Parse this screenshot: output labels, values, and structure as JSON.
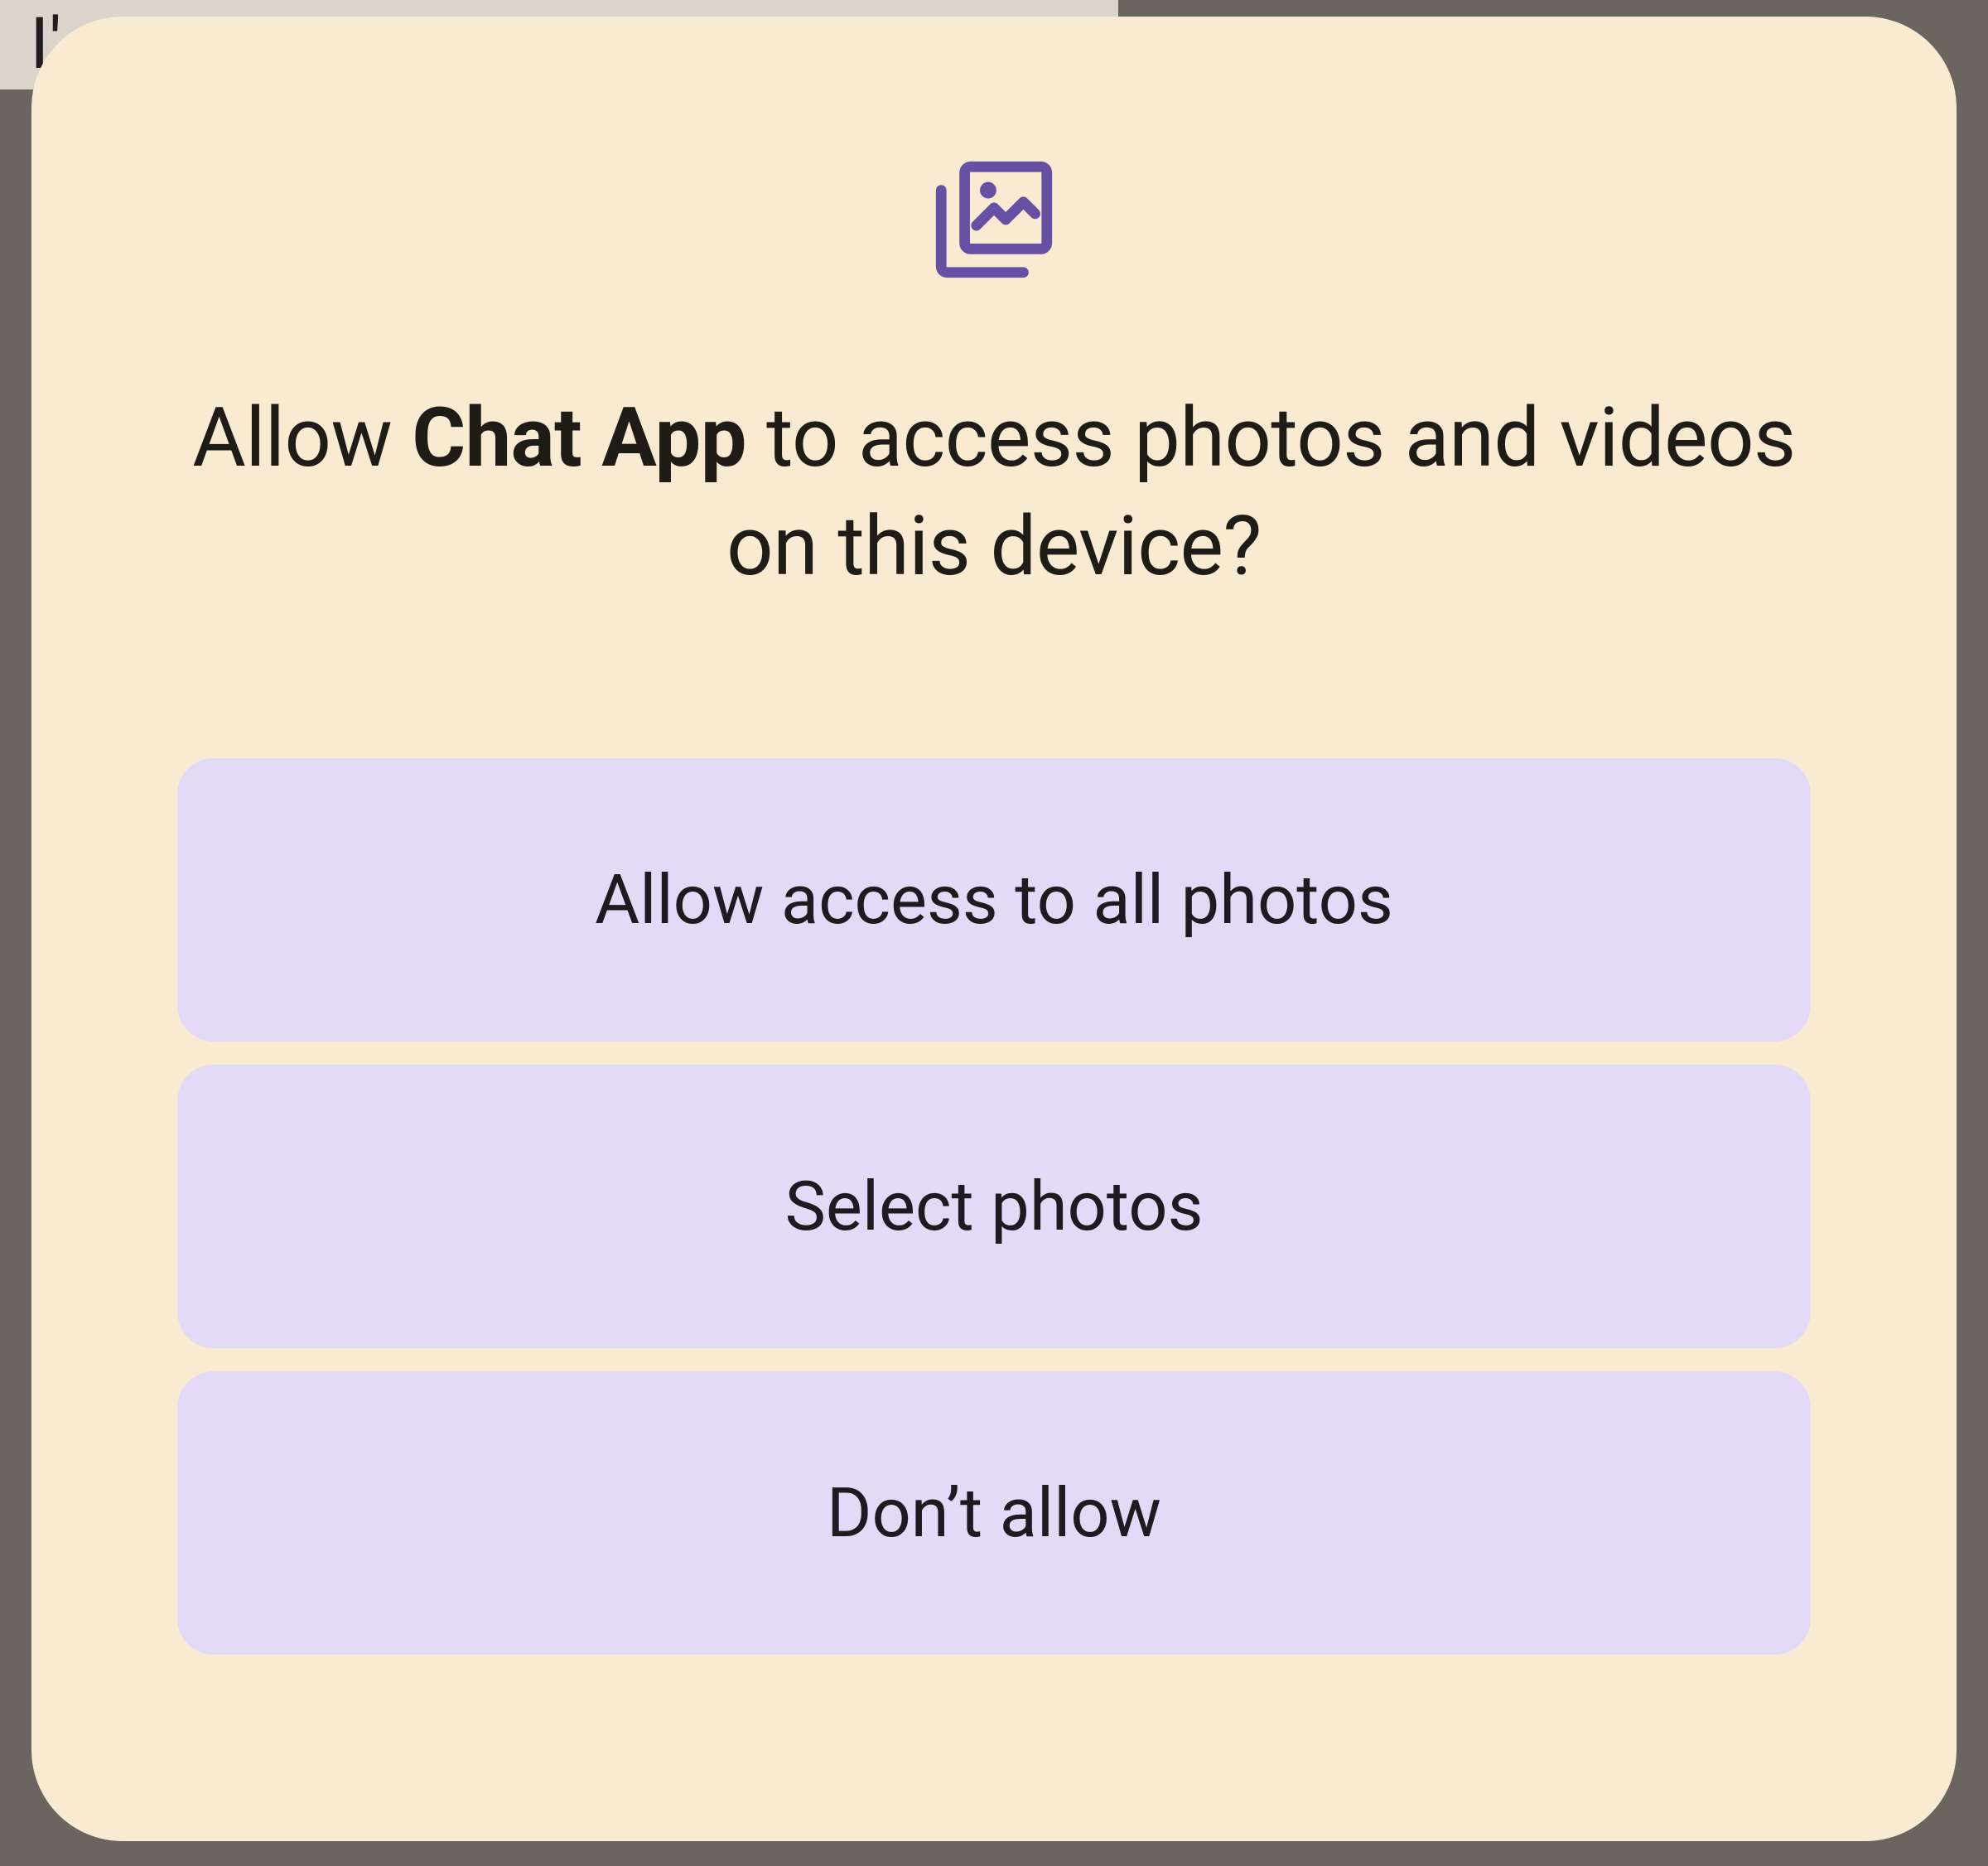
{
  "backdrop": {
    "partial_text": "I'"
  },
  "dialog": {
    "title_prefix": "Allow ",
    "app_name": "Chat App",
    "title_suffix": " to access photos and videos on this device?",
    "buttons": {
      "allow_all": "Allow access to all photos",
      "select": "Select photos",
      "deny": "Don’t allow"
    }
  },
  "colors": {
    "icon_accent": "#6750A4",
    "button_bg": "#e3daf8",
    "dialog_bg": "#f9ead2"
  }
}
